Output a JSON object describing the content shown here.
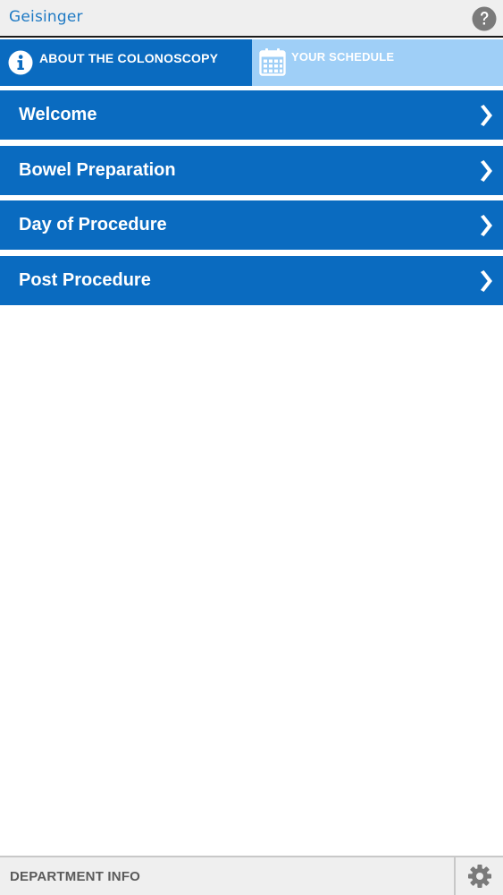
{
  "header": {
    "logo_text": "Geisinger",
    "help_icon": "question-circle-icon"
  },
  "tabs": [
    {
      "label": "ABOUT THE COLONOSCOPY",
      "icon": "info-circle-icon",
      "active": true
    },
    {
      "label": "YOUR SCHEDULE",
      "icon": "calendar-icon",
      "active": false
    }
  ],
  "menu": {
    "items": [
      {
        "label": "Welcome"
      },
      {
        "label": "Bowel Preparation"
      },
      {
        "label": "Day of Procedure"
      },
      {
        "label": "Post Procedure"
      }
    ],
    "chevron_icon": "chevron-right-icon"
  },
  "footer": {
    "department_label": "DEPARTMENT INFO",
    "settings_icon": "gear-icon"
  },
  "colors": {
    "primary_blue": "#0a6bc0",
    "light_blue": "#9fcff7",
    "logo_blue": "#1f7ac4",
    "header_bg": "#efefef"
  }
}
